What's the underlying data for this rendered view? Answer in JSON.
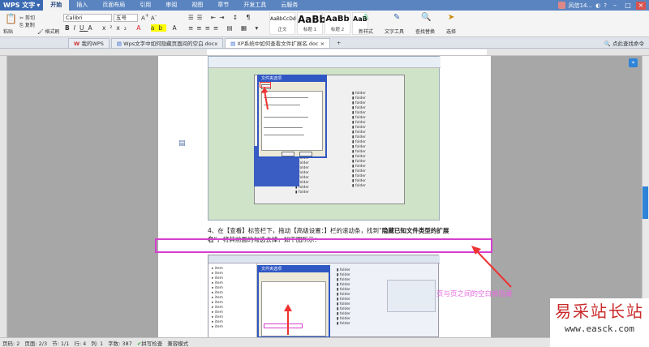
{
  "app": {
    "name": "WPS 文字",
    "menu_tabs": [
      "开始",
      "插入",
      "页面布局",
      "引用",
      "审阅",
      "视图",
      "章节",
      "开发工具",
      "云服务"
    ],
    "active_tab": "开始",
    "user": "风信14..."
  },
  "ribbon": {
    "paste": "粘贴",
    "cut": "剪切",
    "copy": "复制",
    "format_painter": "格式刷",
    "font_name": "Calibri",
    "font_size": "五号",
    "styles": [
      {
        "preview": "AaBbCcDd",
        "label": "正文"
      },
      {
        "preview": "AaBb",
        "label": "标题 1"
      },
      {
        "preview": "AaBb",
        "label": "标题 2"
      },
      {
        "preview": "AaBb",
        "label": ""
      }
    ],
    "new_style": "新样式",
    "text_tools": "文字工具",
    "find_replace": "查找替换",
    "select": "选择"
  },
  "tabs": {
    "home": "我的WPS",
    "docs": [
      "Wps文字中如何隐藏页面间的空白.docx",
      "XP系统中如何查看文件扩展名.doc"
    ],
    "active_index": 1,
    "search": "点此查找命令"
  },
  "document": {
    "para_step": "4、在【查看】标签栏下，拖动【高级设置：】栏的滚动条，找到“",
    "para_bold": "隐藏已知文件类型的扩展名",
    "para_end": "”，将其前面的勾选去掉，如下图所示：",
    "annotation": "页与页之间的空白被隐藏",
    "dialog_title": "文件夹选项"
  },
  "statusbar": {
    "page_num": "页码: 2",
    "pages": "页面: 2/3",
    "section": "节: 1/1",
    "row": "行: 4",
    "col": "列: 1",
    "words": "字数: 387",
    "spell": "拼写检查",
    "mode": "兼容模式"
  },
  "watermark": {
    "cn": "易采站长站",
    "en": "www.easck.com"
  },
  "colors": {
    "title_bar": "#5a84c0",
    "highlight_box": "#d63fd0",
    "annotation": "#e66de0",
    "arrow": "#e53333",
    "watermark": "#c92a2a"
  }
}
